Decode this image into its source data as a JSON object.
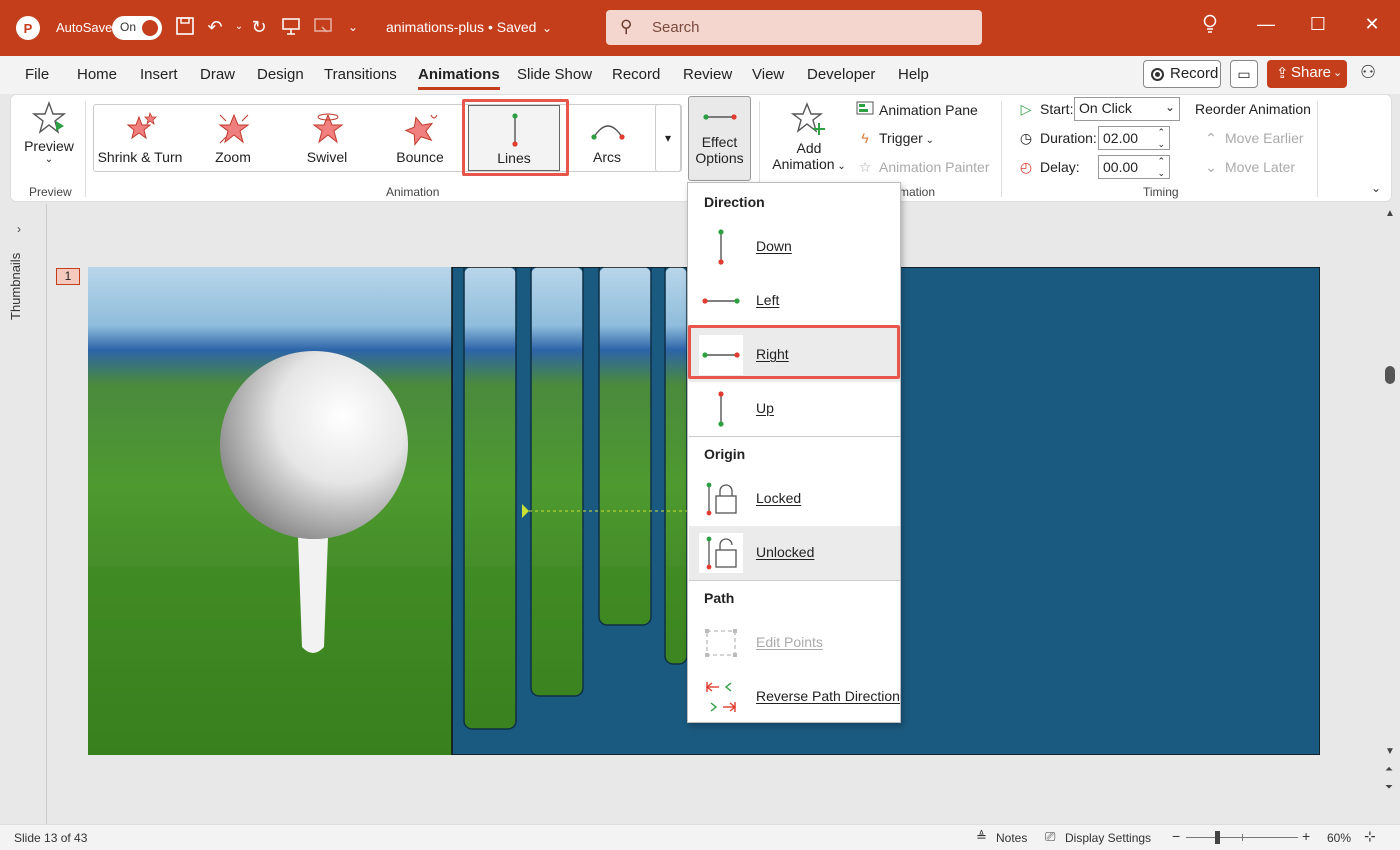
{
  "app": {
    "autosave_label": "AutoSave",
    "autosave_state": "On",
    "document_title": "animations-plus • Saved",
    "search_placeholder": "Search"
  },
  "menu": {
    "tabs": [
      "File",
      "Home",
      "Insert",
      "Draw",
      "Design",
      "Transitions",
      "Animations",
      "Slide Show",
      "Record",
      "Review",
      "View",
      "Developer",
      "Help"
    ],
    "active_tab": "Animations",
    "record_label": "Record",
    "share_label": "Share"
  },
  "ribbon": {
    "preview": {
      "label": "Preview",
      "group": "Preview"
    },
    "animation_group": "Animation",
    "gallery": [
      {
        "label": "Shrink & Turn",
        "icon": "shrink-turn-icon"
      },
      {
        "label": "Zoom",
        "icon": "zoom-icon"
      },
      {
        "label": "Swivel",
        "icon": "swivel-icon"
      },
      {
        "label": "Bounce",
        "icon": "bounce-icon"
      },
      {
        "label": "Lines",
        "icon": "lines-icon",
        "selected": true
      },
      {
        "label": "Arcs",
        "icon": "arcs-icon"
      }
    ],
    "effect_options": {
      "line1": "Effect",
      "line2": "Options"
    },
    "add_animation": {
      "line1": "Add",
      "line2": "Animation"
    },
    "animation_pane": "Animation Pane",
    "trigger": "Trigger",
    "animation_painter": "Animation Painter",
    "advanced_group_partial": "mation",
    "timing": {
      "group": "Timing",
      "start_label": "Start:",
      "start_value": "On Click",
      "duration_label": "Duration:",
      "duration_value": "02.00",
      "delay_label": "Delay:",
      "delay_value": "00.00",
      "reorder_label": "Reorder Animation",
      "move_earlier": "Move Earlier",
      "move_later": "Move Later"
    }
  },
  "sidebar": {
    "thumbnails_label": "Thumbnails",
    "slide_number": "1"
  },
  "dropdown": {
    "direction_header": "Direction",
    "direction_items": [
      "Down",
      "Left",
      "Right",
      "Up"
    ],
    "direction_selected": "Right",
    "origin_header": "Origin",
    "origin_items": [
      "Locked",
      "Unlocked"
    ],
    "origin_selected": "Unlocked",
    "path_header": "Path",
    "path_items": [
      "Edit Points",
      "Reverse Path Direction"
    ]
  },
  "status": {
    "slide_info": "Slide 13 of 43",
    "notes": "Notes",
    "display_settings": "Display Settings",
    "zoom": "60%"
  },
  "colors": {
    "accent": "#c43e1c",
    "highlight": "#e8554a",
    "slide_bg": "#1b5a80",
    "line_start": "#2ea043",
    "line_end": "#e03c31"
  }
}
